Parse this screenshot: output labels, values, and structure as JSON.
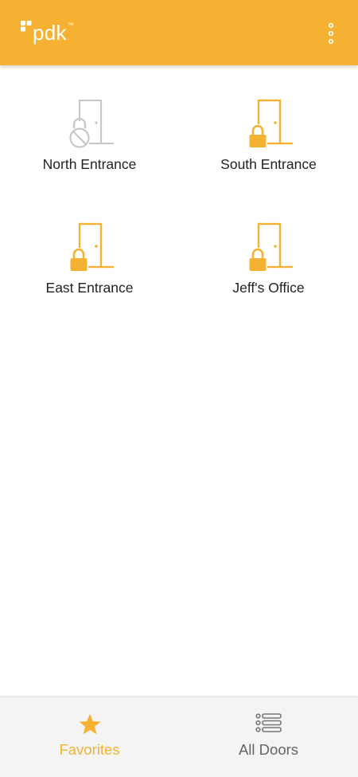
{
  "colors": {
    "brand": "#f5b232",
    "disabled": "#c8c8c8",
    "text": "#222222",
    "tab_inactive": "#666666"
  },
  "header": {
    "logo_text": "pdk",
    "logo_tm": "™",
    "menu_icon": "vertical-dots-icon"
  },
  "doors": [
    {
      "label": "North Entrance",
      "state": "disabled",
      "icon": "door-disabled-lock-icon"
    },
    {
      "label": "South Entrance",
      "state": "locked",
      "icon": "door-lock-icon"
    },
    {
      "label": "East Entrance",
      "state": "locked",
      "icon": "door-lock-icon"
    },
    {
      "label": "Jeff's Office",
      "state": "locked",
      "icon": "door-lock-icon"
    }
  ],
  "tabs": [
    {
      "label": "Favorites",
      "icon": "star-icon",
      "active": true
    },
    {
      "label": "All Doors",
      "icon": "list-icon",
      "active": false
    }
  ]
}
